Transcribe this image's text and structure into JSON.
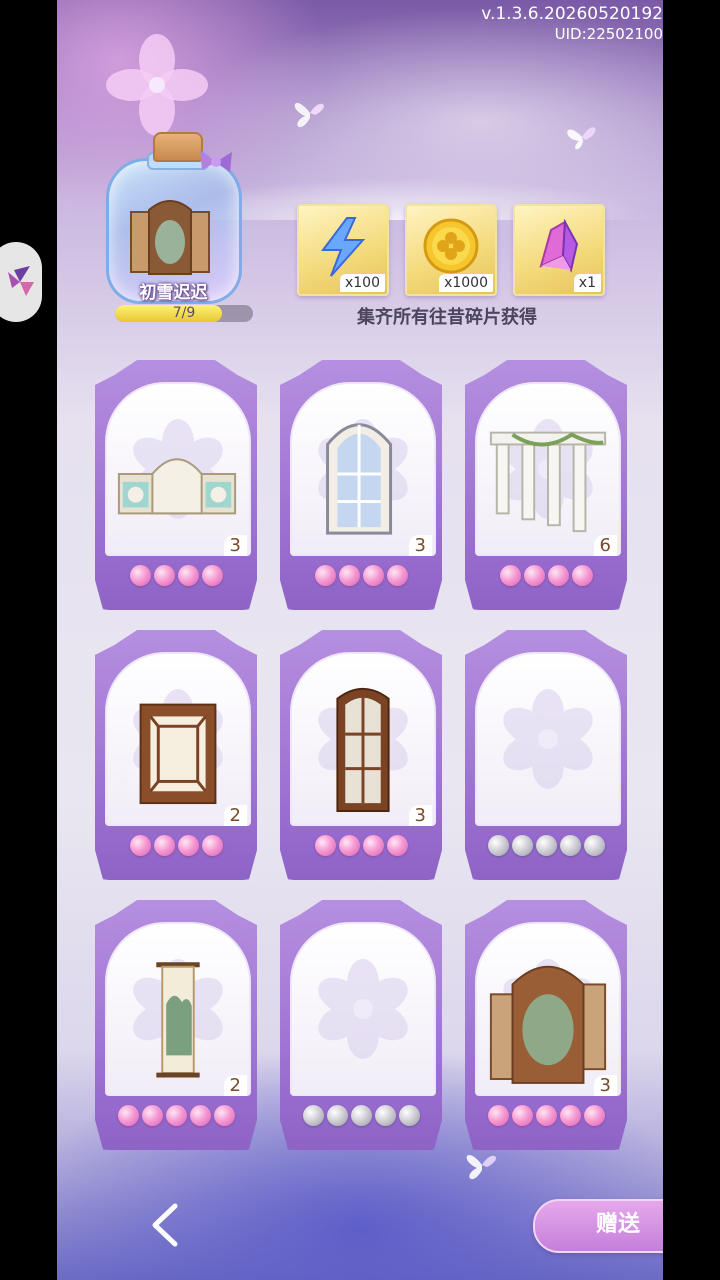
{
  "version": {
    "line1": "v.1.3.6.20260520192",
    "uid": "UID:22502100"
  },
  "collection": {
    "name": "初雪迟迟",
    "progress_text": "7/9",
    "progress_value": 0.778
  },
  "rewards": [
    {
      "icon": "lightning-icon",
      "count": "x100"
    },
    {
      "icon": "clover-coin-icon",
      "count": "x1000"
    },
    {
      "icon": "crystal-icon",
      "count": "x1"
    }
  ],
  "reward_caption": "集齐所有往昔碎片获得",
  "cards": [
    {
      "item": "arch-wall-icon",
      "count": "3",
      "beads": [
        "pink",
        "pink",
        "pink",
        "pink"
      ]
    },
    {
      "item": "arched-window-icon",
      "count": "3",
      "beads": [
        "pink",
        "pink",
        "pink",
        "pink"
      ]
    },
    {
      "item": "colonnade-icon",
      "count": "6",
      "beads": [
        "pink",
        "pink",
        "pink",
        "pink"
      ]
    },
    {
      "item": "lattice-window-icon",
      "count": "2",
      "beads": [
        "pink",
        "pink",
        "pink",
        "pink"
      ]
    },
    {
      "item": "wooden-window-icon",
      "count": "3",
      "beads": [
        "pink",
        "pink",
        "pink",
        "pink"
      ]
    },
    {
      "item": "empty-slot-icon",
      "count": "",
      "beads": [
        "grey",
        "grey",
        "grey",
        "grey",
        "grey"
      ]
    },
    {
      "item": "scroll-painting-icon",
      "count": "2",
      "beads": [
        "pink",
        "pink",
        "pink",
        "pink",
        "pink"
      ]
    },
    {
      "item": "empty-slot-icon",
      "count": "",
      "beads": [
        "grey",
        "grey",
        "grey",
        "grey",
        "grey"
      ]
    },
    {
      "item": "folding-screen-icon",
      "count": "3",
      "beads": [
        "pink",
        "pink",
        "pink",
        "pink",
        "pink"
      ]
    }
  ],
  "buttons": {
    "gift": "赠送",
    "back_icon": "back-arrow-icon"
  },
  "colors": {
    "accent": "#9a6fd0",
    "bead_pink": "#f59ad3",
    "bead_grey": "#cfcfd6",
    "reward_gold": "#f3d97a"
  }
}
